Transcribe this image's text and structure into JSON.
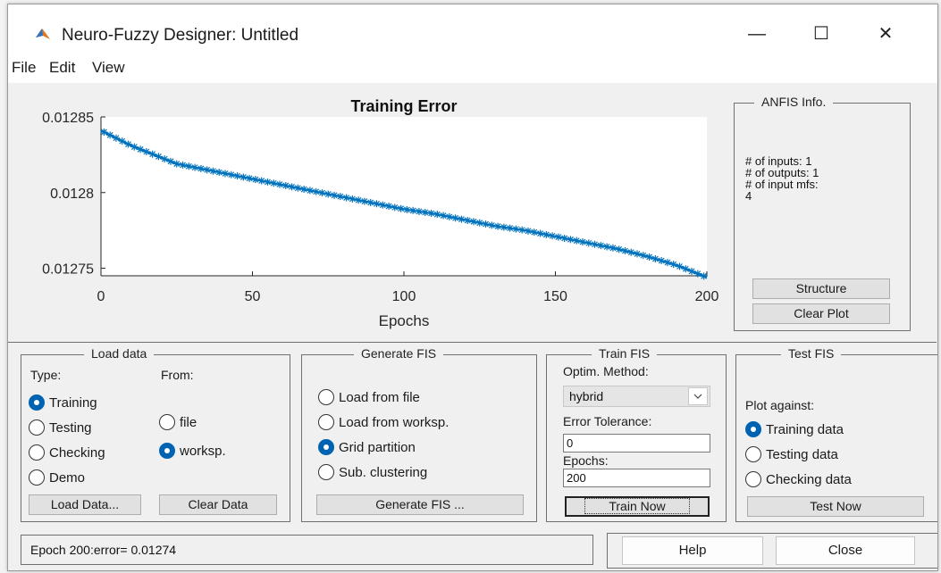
{
  "window": {
    "title": "Neuro-Fuzzy Designer: Untitled",
    "controls": {
      "minimize": "—",
      "maximize": "☐",
      "close": "✕"
    }
  },
  "menu": [
    "File",
    "Edit",
    "View"
  ],
  "chart_data": {
    "type": "line",
    "title": "Training Error",
    "xlabel": "Epochs",
    "ylabel": "",
    "xlim": [
      0,
      200
    ],
    "ylim": [
      0.012745,
      0.01285
    ],
    "x_ticks": [
      "0",
      "50",
      "100",
      "150",
      "200"
    ],
    "y_ticks": [
      "0.01285",
      "0.0128",
      "0.01275"
    ],
    "marker": "asterisk",
    "color": "#0072bd",
    "series": [
      {
        "x": [
          0,
          10,
          20,
          25,
          30,
          40,
          50,
          60,
          70,
          80,
          90,
          100,
          110,
          120,
          130,
          140,
          150,
          160,
          170,
          180,
          190,
          200
        ],
        "y": [
          0.012841,
          0.012831,
          0.012823,
          0.012819,
          0.012817,
          0.012813,
          0.012809,
          0.012805,
          0.012801,
          0.012797,
          0.012793,
          0.012789,
          0.012786,
          0.012782,
          0.012778,
          0.012775,
          0.012771,
          0.012767,
          0.012763,
          0.012758,
          0.012752,
          0.012744
        ]
      }
    ]
  },
  "anfis_info": {
    "title": "ANFIS Info.",
    "lines": [
      "# of inputs: 1",
      "# of outputs: 1",
      "# of input mfs:",
      "4"
    ],
    "structure_btn": "Structure",
    "clear_plot_btn": "Clear Plot"
  },
  "load_data": {
    "title": "Load data",
    "type_label": "Type:",
    "from_label": "From:",
    "types": [
      "Training",
      "Testing",
      "Checking",
      "Demo"
    ],
    "type_selected": "Training",
    "froms": [
      "file",
      "worksp."
    ],
    "from_selected": "worksp.",
    "load_btn": "Load Data...",
    "clear_btn": "Clear Data"
  },
  "generate_fis": {
    "title": "Generate FIS",
    "options": [
      "Load from file",
      "Load from worksp.",
      "Grid partition",
      "Sub. clustering"
    ],
    "selected": "Grid partition",
    "btn": "Generate FIS ..."
  },
  "train_fis": {
    "title": "Train FIS",
    "method_label": "Optim. Method:",
    "method_value": "hybrid",
    "tol_label": "Error Tolerance:",
    "tol_value": "0",
    "epochs_label": "Epochs:",
    "epochs_value": "200",
    "btn": "Train Now"
  },
  "test_fis": {
    "title": "Test FIS",
    "plot_against_label": "Plot against:",
    "options": [
      "Training data",
      "Testing data",
      "Checking data"
    ],
    "selected": "Training data",
    "btn": "Test Now"
  },
  "status_text": "Epoch 200:error= 0.01274",
  "help_btn": "Help",
  "close_btn": "Close"
}
